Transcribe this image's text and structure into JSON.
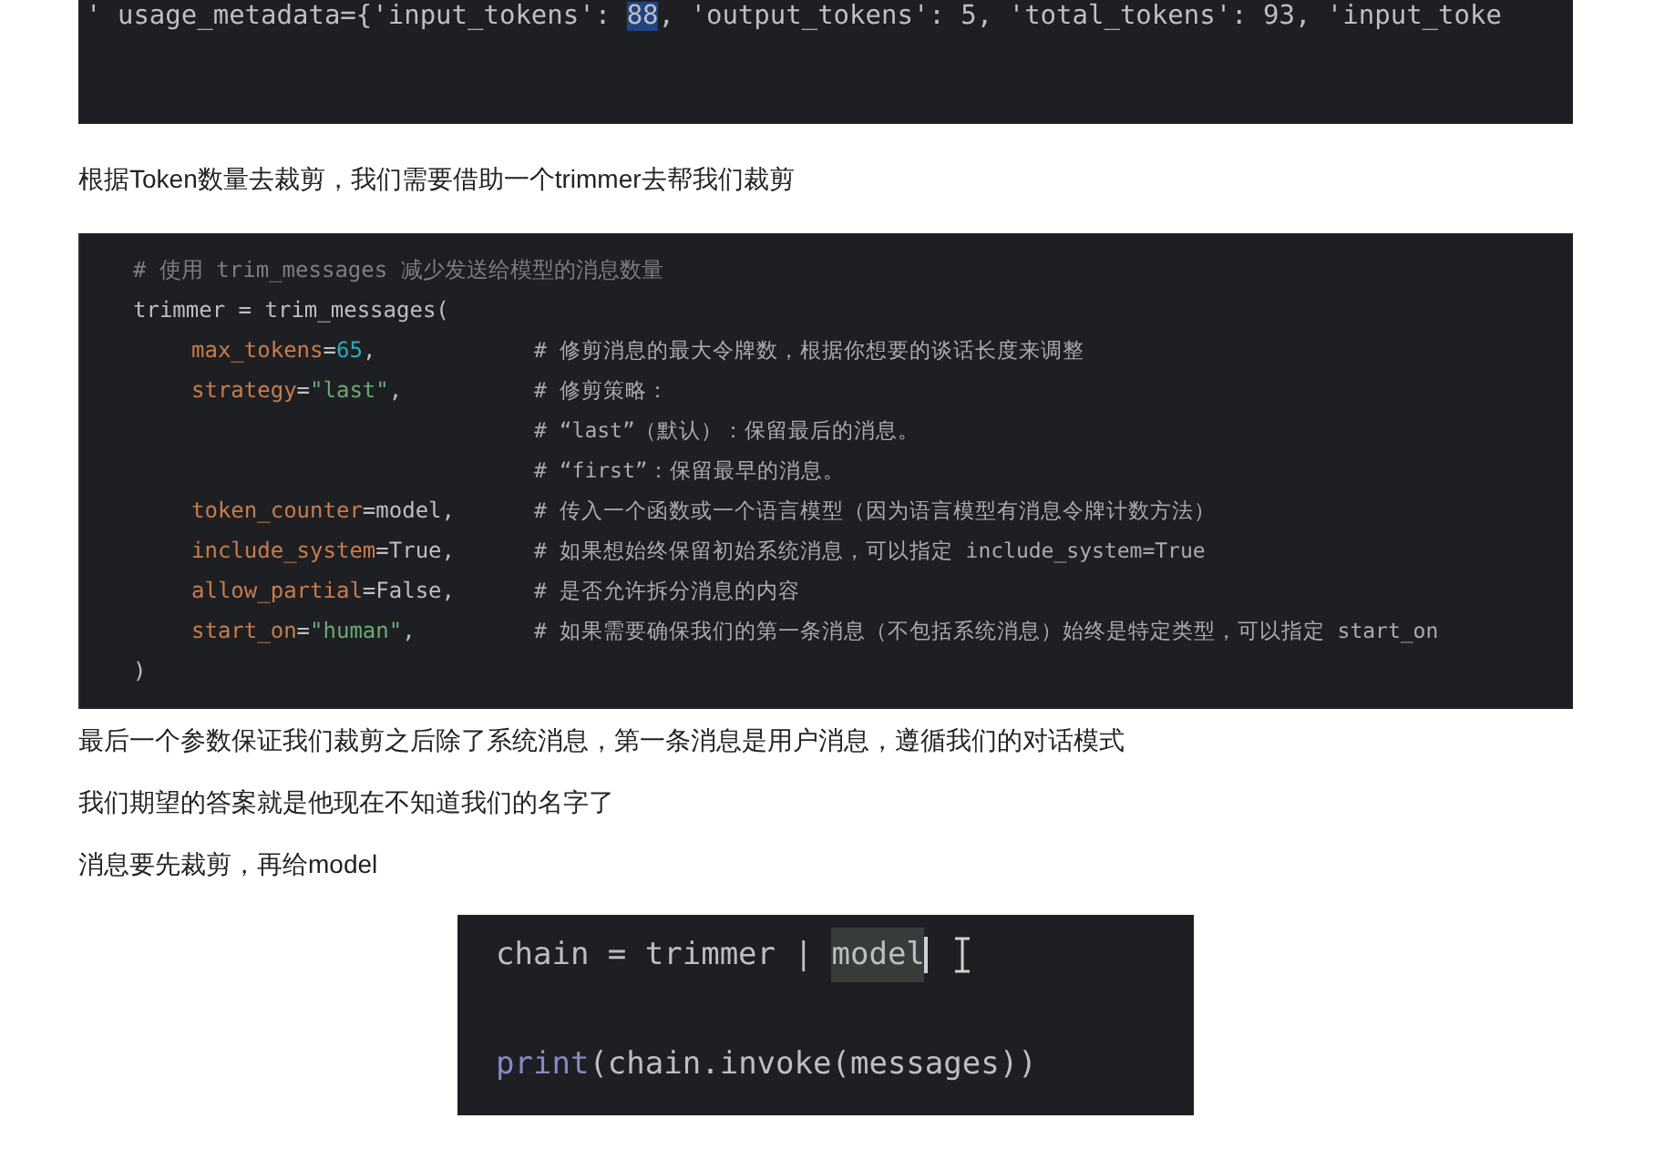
{
  "blocks": [
    {
      "kind": "console",
      "lines": [
        {
          "tokens": [
            {
              "text": "' usage_metadata={'input_tokens': ",
              "kind": "plain"
            },
            {
              "text": "88",
              "kind": "selected"
            },
            {
              "text": ", 'output_tokens': 5, 'total_tokens': 93, 'input_toke",
              "kind": "plain"
            }
          ]
        }
      ]
    },
    {
      "kind": "paragraph",
      "text": "根据Token数量去裁剪，我们需要借助一个trimmer去帮我们裁剪"
    },
    {
      "kind": "code",
      "lines": [
        {
          "indent": false,
          "tokens": [
            {
              "text": "# 使用 trim_messages 减少发送给模型的消息数量",
              "kind": "comment"
            }
          ]
        },
        {
          "indent": false,
          "tokens": [
            {
              "text": "trimmer = trim_messages(",
              "kind": "plain"
            }
          ]
        },
        {
          "indent": true,
          "tokens": [
            {
              "text": "max_tokens",
              "kind": "param"
            },
            {
              "text": "=",
              "kind": "plain"
            },
            {
              "text": "65",
              "kind": "number"
            },
            {
              "text": ",",
              "kind": "plain"
            }
          ],
          "comment": "# 修剪消息的最大令牌数，根据你想要的谈话长度来调整"
        },
        {
          "indent": true,
          "tokens": [
            {
              "text": "strategy",
              "kind": "param"
            },
            {
              "text": "=",
              "kind": "plain"
            },
            {
              "text": "\"last\"",
              "kind": "string"
            },
            {
              "text": ",",
              "kind": "plain"
            }
          ],
          "comment": "# 修剪策略："
        },
        {
          "comment": "# “last”（默认）：保留最后的消息。"
        },
        {
          "comment": "# “first”：保留最早的消息。"
        },
        {
          "indent": true,
          "tokens": [
            {
              "text": "token_counter",
              "kind": "param"
            },
            {
              "text": "=model,",
              "kind": "plain"
            }
          ],
          "comment": "# 传入一个函数或一个语言模型（因为语言模型有消息令牌计数方法）"
        },
        {
          "indent": true,
          "tokens": [
            {
              "text": "include_system",
              "kind": "param"
            },
            {
              "text": "=True,",
              "kind": "plain"
            }
          ],
          "comment": "# 如果想始终保留初始系统消息，可以指定 include_system=True"
        },
        {
          "indent": true,
          "tokens": [
            {
              "text": "allow_partial",
              "kind": "param"
            },
            {
              "text": "=False,",
              "kind": "plain"
            }
          ],
          "comment": "# 是否允许拆分消息的内容"
        },
        {
          "indent": true,
          "tokens": [
            {
              "text": "start_on",
              "kind": "param"
            },
            {
              "text": "=",
              "kind": "plain"
            },
            {
              "text": "\"human\"",
              "kind": "string"
            },
            {
              "text": ",",
              "kind": "plain"
            }
          ],
          "comment": "# 如果需要确保我们的第一条消息（不包括系统消息）始终是特定类型，可以指定 start_on"
        },
        {
          "indent": false,
          "tokens": [
            {
              "text": ")",
              "kind": "plain"
            }
          ]
        }
      ]
    },
    {
      "kind": "paragraph",
      "text": "最后一个参数保证我们裁剪之后除了系统消息，第一条消息是用户消息，遵循我们的对话模式"
    },
    {
      "kind": "paragraph",
      "text": "我们期望的答案就是他现在不知道我们的名字了"
    },
    {
      "kind": "paragraph",
      "text": "消息要先裁剪，再给model"
    },
    {
      "kind": "snippet",
      "lines": [
        {
          "tokens": [
            {
              "text": "chain = trimmer | ",
              "kind": "plain"
            },
            {
              "text": "model",
              "kind": "highlight"
            }
          ],
          "cursor": true
        },
        {
          "cursor": false
        },
        {
          "tokens": [
            {
              "text": "print",
              "kind": "builtin"
            },
            {
              "text": "(chain.invoke(messages))",
              "kind": "plain"
            }
          ]
        }
      ]
    }
  ]
}
